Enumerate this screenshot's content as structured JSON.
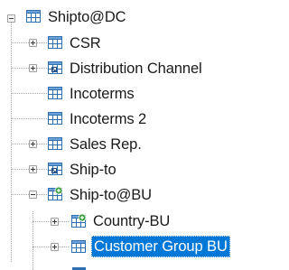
{
  "tree": {
    "root": {
      "label": "Shipto@DC",
      "icon": "table-icon",
      "state": "expanded"
    },
    "children": [
      {
        "label": "CSR",
        "icon": "table-icon",
        "state": "collapsed"
      },
      {
        "label": "Distribution Channel",
        "icon": "linked-table-icon",
        "state": "collapsed"
      },
      {
        "label": "Incoterms",
        "icon": "table-icon",
        "state": "leaf"
      },
      {
        "label": "Incoterms 2",
        "icon": "table-icon",
        "state": "leaf"
      },
      {
        "label": "Sales Rep.",
        "icon": "table-icon",
        "state": "collapsed"
      },
      {
        "label": "Ship-to",
        "icon": "linked-table-icon",
        "state": "collapsed"
      },
      {
        "label": "Ship-to@BU",
        "icon": "table-green-icon",
        "state": "expanded"
      }
    ],
    "grandchildren": [
      {
        "label": "Country-BU",
        "icon": "table-green-icon",
        "state": "collapsed"
      },
      {
        "label": "Customer Group BU",
        "icon": "table-icon",
        "state": "collapsed",
        "selected": true
      }
    ],
    "colors": {
      "selection": "#0078d7",
      "connector": "#a7a7a7",
      "icon_blue": "#2d6fb0",
      "icon_green": "#3ca03c"
    }
  }
}
